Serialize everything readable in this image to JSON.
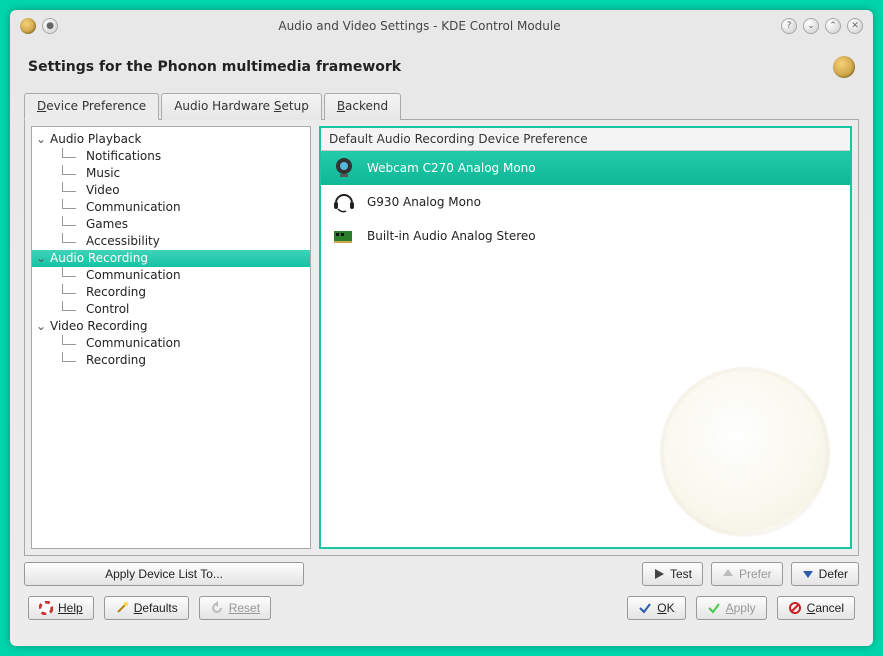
{
  "window": {
    "title": "Audio and Video Settings - KDE Control Module"
  },
  "header": {
    "title": "Settings for the Phonon multimedia framework"
  },
  "tabs": [
    {
      "label_pre": "",
      "u": "D",
      "label_post": "evice Preference",
      "active": true
    },
    {
      "label_pre": "Audio Hardware ",
      "u": "S",
      "label_post": "etup",
      "active": false
    },
    {
      "label_pre": "",
      "u": "B",
      "label_post": "ackend",
      "active": false
    }
  ],
  "tree": {
    "items": [
      {
        "label": "Audio Playback",
        "depth": 0,
        "expandable": true
      },
      {
        "label": "Notifications",
        "depth": 1
      },
      {
        "label": "Music",
        "depth": 1
      },
      {
        "label": "Video",
        "depth": 1
      },
      {
        "label": "Communication",
        "depth": 1
      },
      {
        "label": "Games",
        "depth": 1
      },
      {
        "label": "Accessibility",
        "depth": 1
      },
      {
        "label": "Audio Recording",
        "depth": 0,
        "expandable": true,
        "selected": true
      },
      {
        "label": "Communication",
        "depth": 1
      },
      {
        "label": "Recording",
        "depth": 1
      },
      {
        "label": "Control",
        "depth": 1
      },
      {
        "label": "Video Recording",
        "depth": 0,
        "expandable": true
      },
      {
        "label": "Communication",
        "depth": 1
      },
      {
        "label": "Recording",
        "depth": 1
      }
    ],
    "apply_to_label": "Apply Device List To..."
  },
  "devices": {
    "header": "Default Audio Recording Device Preference",
    "items": [
      {
        "label": "Webcam C270 Analog Mono",
        "icon": "webcam",
        "selected": true
      },
      {
        "label": "G930 Analog Mono",
        "icon": "headset",
        "selected": false
      },
      {
        "label": "Built-in Audio Analog Stereo",
        "icon": "soundcard",
        "selected": false
      }
    ],
    "buttons": {
      "test": "Test",
      "prefer": "Prefer",
      "defer": "Defer"
    }
  },
  "bottom": {
    "help": "Help",
    "defaults": "Defaults",
    "reset": "Reset",
    "ok": "OK",
    "apply": "Apply",
    "cancel": "Cancel"
  },
  "titlebar_icons": {
    "help": "?",
    "down": "⌄",
    "up": "⌃",
    "close": "✕"
  }
}
